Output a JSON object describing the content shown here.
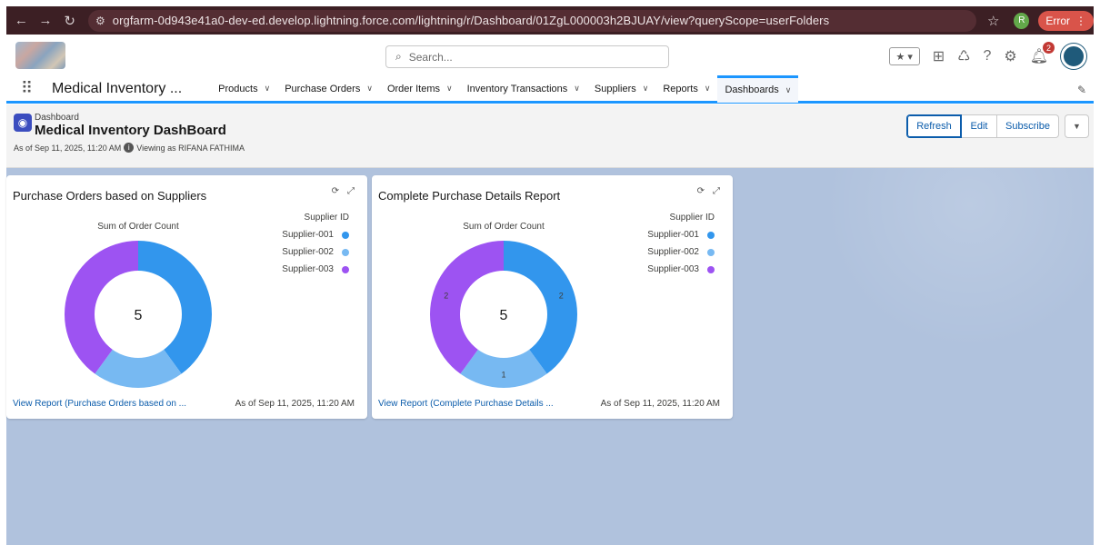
{
  "browser": {
    "url": "orgfarm-0d943e41a0-dev-ed.develop.lightning.force.com/lightning/r/Dashboard/01ZgL000003h2BJUAY/view?queryScope=userFolders",
    "profile_initial": "R",
    "error_label": "Error"
  },
  "header": {
    "search_placeholder": "Search...",
    "notification_count": "2"
  },
  "nav": {
    "app_name": "Medical Inventory ...",
    "items": [
      {
        "label": "Products"
      },
      {
        "label": "Purchase Orders"
      },
      {
        "label": "Order Items"
      },
      {
        "label": "Inventory Transactions"
      },
      {
        "label": "Suppliers"
      },
      {
        "label": "Reports"
      },
      {
        "label": "Dashboards"
      }
    ]
  },
  "page": {
    "object_label": "Dashboard",
    "title": "Medical Inventory DashBoard",
    "as_of": "As of Sep 11, 2025, 11:20 AM",
    "viewing_as": "Viewing as RIFANA FATHIMA",
    "buttons": {
      "refresh": "Refresh",
      "edit": "Edit",
      "subscribe": "Subscribe"
    }
  },
  "colors": {
    "supplier_001": "#3296ed",
    "supplier_002": "#77b9f2",
    "supplier_003": "#9d53f2"
  },
  "cards": [
    {
      "title": "Purchase Orders based on Suppliers",
      "footer_link": "View Report (Purchase Orders based on ...",
      "footer_time": "As of Sep 11, 2025, 11:20 AM"
    },
    {
      "title": "Complete Purchase Details Report",
      "footer_link": "View Report (Complete Purchase Details ...",
      "footer_time": "As of Sep 11, 2025, 11:20 AM"
    }
  ],
  "chart_data": [
    {
      "type": "pie",
      "subtype": "donut",
      "title": "Sum of Order Count",
      "legend_title": "Supplier ID",
      "categories": [
        "Supplier-001",
        "Supplier-002",
        "Supplier-003"
      ],
      "values": [
        2,
        1,
        2
      ],
      "total": "5",
      "show_slice_labels": false,
      "legend_position": "top-right"
    },
    {
      "type": "pie",
      "subtype": "donut",
      "title": "Sum of Order Count",
      "legend_title": "Supplier ID",
      "categories": [
        "Supplier-001",
        "Supplier-002",
        "Supplier-003"
      ],
      "values": [
        2,
        1,
        2
      ],
      "total": "5",
      "show_slice_labels": true,
      "legend_position": "top-right"
    }
  ]
}
